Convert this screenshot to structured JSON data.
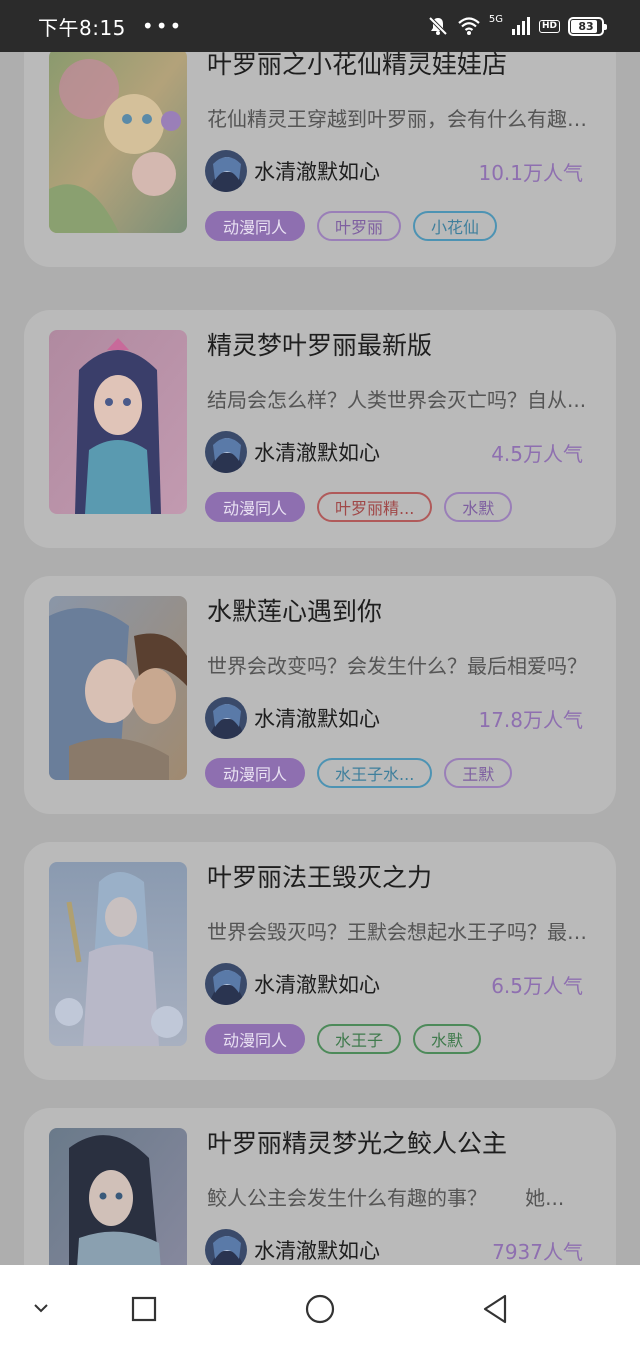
{
  "status_bar": {
    "time": "下午8:15",
    "dots": "•••",
    "network": "5G",
    "hd": "HD",
    "battery": "83"
  },
  "cards": [
    {
      "title": "叶罗丽之小花仙精灵娃娃店",
      "desc": "花仙精灵王穿越到叶罗丽，会有什么有趣的事？",
      "author": "水清澈默如心",
      "popularity": "10.1万人气",
      "tags": [
        {
          "label": "动漫同人",
          "style": "filled",
          "color": "#8e6fb0"
        },
        {
          "label": "叶罗丽",
          "style": "outline",
          "color": "#9a7fb8"
        },
        {
          "label": "小花仙",
          "style": "outline",
          "color": "#4d93b3"
        }
      ]
    },
    {
      "title": "精灵梦叶罗丽最新版",
      "desc": "结局会怎么样？人类世界会灭亡吗？自从...",
      "author": "水清澈默如心",
      "popularity": "4.5万人气",
      "tags": [
        {
          "label": "动漫同人",
          "style": "filled",
          "color": "#8e6fb0"
        },
        {
          "label": "叶罗丽精...",
          "style": "outline",
          "color": "#b05a5a"
        },
        {
          "label": "水默",
          "style": "outline",
          "color": "#9a7fb8"
        }
      ]
    },
    {
      "title": "水默莲心遇到你",
      "desc": "世界会改变吗？会发生什么？最后相爱吗？",
      "author": "水清澈默如心",
      "popularity": "17.8万人气",
      "tags": [
        {
          "label": "动漫同人",
          "style": "filled",
          "color": "#8e6fb0"
        },
        {
          "label": "水王子水...",
          "style": "outline",
          "color": "#4d93b3"
        },
        {
          "label": "王默",
          "style": "outline",
          "color": "#9a7fb8"
        }
      ]
    },
    {
      "title": "叶罗丽法王毁灭之力",
      "desc": "世界会毁灭吗？王默会想起水王子吗？最后...",
      "author": "水清澈默如心",
      "popularity": "6.5万人气",
      "tags": [
        {
          "label": "动漫同人",
          "style": "filled",
          "color": "#8e6fb0"
        },
        {
          "label": "水王子",
          "style": "outline",
          "color": "#4d8a5a"
        },
        {
          "label": "水默",
          "style": "outline",
          "color": "#4d8a5a"
        }
      ]
    },
    {
      "title": "叶罗丽精灵梦光之鲛人公主",
      "desc": "鲛人公主会发生什么有趣的事？      她...",
      "author": "水清澈默如心",
      "popularity": "7937人气",
      "tags": []
    }
  ],
  "nav_bar": {
    "icons": [
      "chevron-down-icon",
      "recent-apps-icon",
      "home-icon",
      "back-icon"
    ]
  }
}
